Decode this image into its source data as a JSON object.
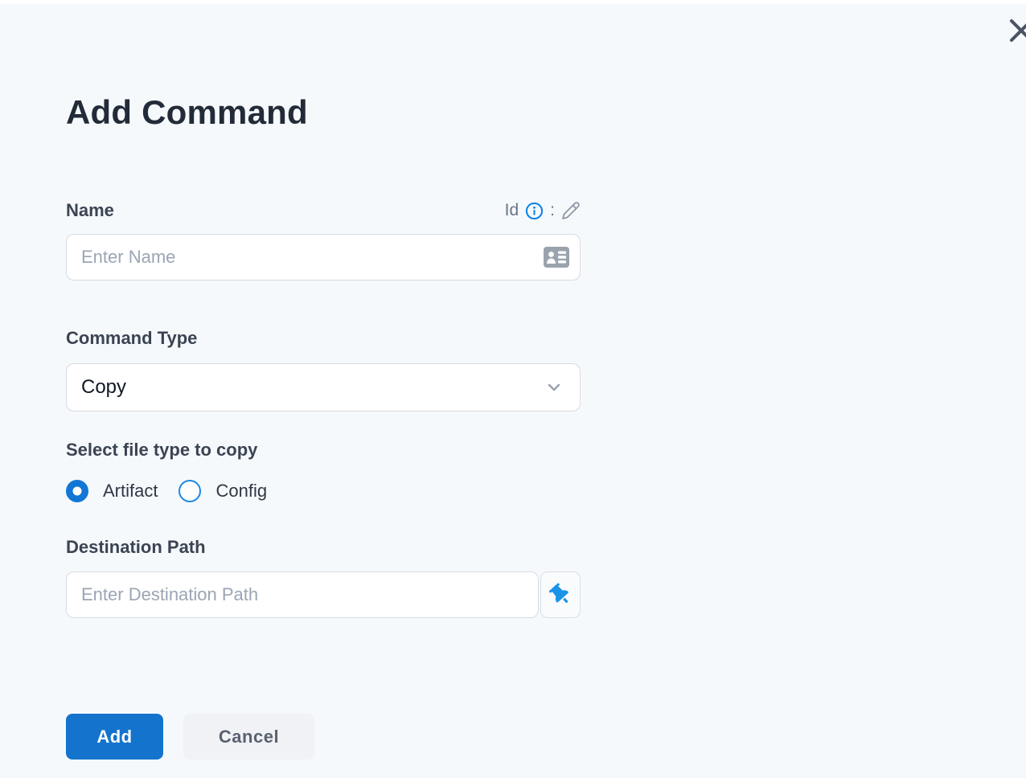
{
  "modal": {
    "title": "Add Command"
  },
  "fields": {
    "name": {
      "label": "Name",
      "placeholder": "Enter Name",
      "value": "",
      "id_label": "Id",
      "id_separator": ":"
    },
    "command_type": {
      "label": "Command Type",
      "selected_value": "Copy"
    },
    "file_type": {
      "label": "Select file type to copy",
      "options": [
        {
          "label": "Artifact",
          "selected": true
        },
        {
          "label": "Config",
          "selected": false
        }
      ]
    },
    "destination_path": {
      "label": "Destination Path",
      "placeholder": "Enter Destination Path",
      "value": ""
    }
  },
  "buttons": {
    "add": "Add",
    "cancel": "Cancel"
  },
  "icons": {
    "close": "✕",
    "info": "ⓘ",
    "edit_pencil": "✎",
    "contact_card": "id-card glyph",
    "chevron_down": "⌄",
    "pushpin": "📌"
  },
  "colors": {
    "background": "#f5f9fc",
    "accent_blue": "#1473cc",
    "radio_blue": "#1277d4",
    "pin_blue": "#1b93e8",
    "info_blue": "#1284e8",
    "title_text": "#222b38",
    "label_text": "#3b4452",
    "placeholder_text": "#9ba5b4",
    "input_border": "#d7dbe1",
    "cancel_bg": "#f0f2f5",
    "cancel_text": "#5a626f"
  }
}
